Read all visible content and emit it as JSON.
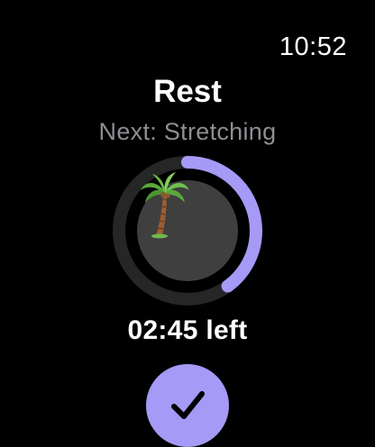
{
  "status_bar": {
    "time": "10:52"
  },
  "workout": {
    "title": "Rest",
    "next_label": "Next: Stretching",
    "time_left": "02:45 left",
    "progress_fraction": 0.4,
    "center_icon": "palm-tree-icon"
  },
  "actions": {
    "done_icon": "checkmark-icon"
  },
  "colors": {
    "accent": "#a59af6",
    "ring_track": "#262626",
    "inner_circle": "#3f3f3f",
    "subtitle": "#8e8e93",
    "background": "#000000"
  }
}
